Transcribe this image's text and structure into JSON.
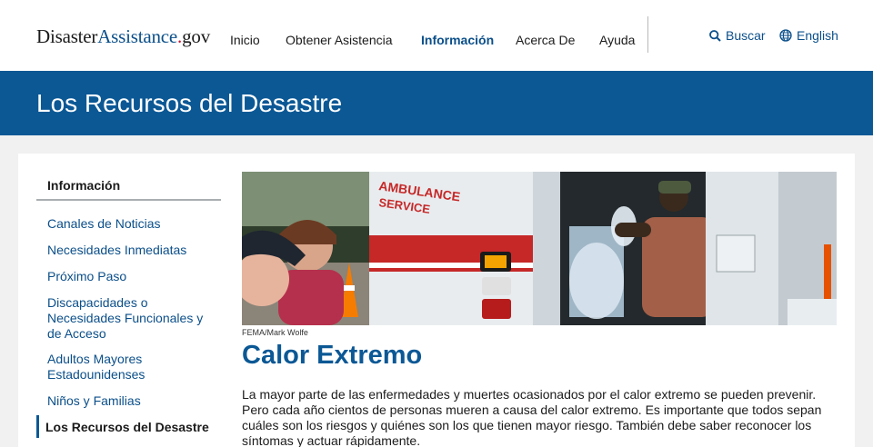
{
  "header": {
    "logo": {
      "part1": "Disaster",
      "part2": "Assistance",
      "dot": ".",
      "part3": "gov"
    },
    "nav": [
      {
        "label": "Inicio",
        "active": false
      },
      {
        "label": "Obtener Asistencia",
        "active": false
      },
      {
        "label": "Información",
        "active": true
      },
      {
        "label": "Acerca De",
        "active": false
      },
      {
        "label": "Ayuda",
        "active": false
      }
    ],
    "search_label": "Buscar",
    "language_label": "English"
  },
  "banner": {
    "title": "Los Recursos del Desastre"
  },
  "sidebar": {
    "heading": "Información",
    "items": [
      {
        "label": "Canales de Noticias"
      },
      {
        "label": "Necesidades Inmediatas"
      },
      {
        "label": "Próximo Paso"
      },
      {
        "label": "Discapacidades o Necesidades Funcionales y de Acceso"
      },
      {
        "label": "Adultos Mayores Estadounidenses"
      },
      {
        "label": "Niños y Familias"
      },
      {
        "label": "Los Recursos del Desastre",
        "current": true
      }
    ]
  },
  "main": {
    "image_caption": "FEMA/Mark Wolfe",
    "hero_text": {
      "line1": "AMBULANCE",
      "line2": "SERVICE"
    },
    "title": "Calor Extremo",
    "body": "La mayor parte de las enfermedades y muertes ocasionados por el calor extremo se pueden prevenir. Pero cada año cientos de personas mueren a causa del calor extremo. Es importante que todos sepan cuáles son los riesgos y quiénes son los que tienen mayor riesgo. También debe saber reconocer los síntomas y actuar rápidamente."
  },
  "colors": {
    "brand_blue": "#0b5895",
    "link_blue": "#0b4f8a",
    "logo_red": "#c8102e",
    "background": "#f1f1f1"
  },
  "icons": {
    "search": "search-icon",
    "language": "globe-icon"
  }
}
